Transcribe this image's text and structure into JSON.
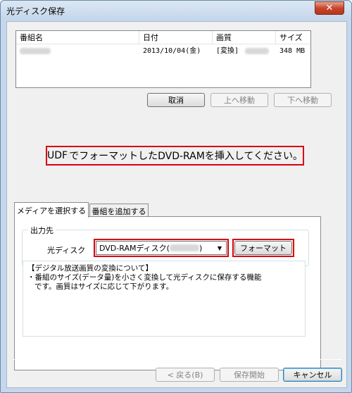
{
  "window": {
    "title": "光ディスク保存",
    "close_label": "✕"
  },
  "list": {
    "headers": [
      "番組名",
      "日付",
      "画質",
      "サイズ"
    ],
    "rows": [
      {
        "name": "",
        "date": "2013/10/04(金)",
        "quality": "[変換]",
        "size": "348 MB"
      }
    ]
  },
  "list_buttons": {
    "cancel": "取消",
    "move_up": "上へ移動",
    "move_down": "下へ移動"
  },
  "message": {
    "prefix": "UDF",
    "suffix": "でフォーマットしたDVD-RAMを挿入してください。"
  },
  "tabs": {
    "select_media": "メディアを選択する",
    "add_program": "番組を追加する"
  },
  "output": {
    "group_title": "出力先",
    "disc_label": "光ディスク",
    "disc_value_prefix": "DVD-RAMディスク(",
    "disc_value_suffix": ")",
    "format_button": "フォーマット"
  },
  "info": {
    "line1": "【デジタル放送画質の変換について】",
    "line2": "・番組のサイズ(データ量)を小さく変換して光ディスクに保存する機能",
    "line3": "です。画質はサイズに応じて下がります。"
  },
  "footer": {
    "back": "< 戻る(B)",
    "start_save": "保存開始",
    "cancel": "キャンセル"
  },
  "colors": {
    "highlight_red": "#d8000f",
    "titlebar": "#c4d7ec",
    "close_red": "#c8452c"
  }
}
